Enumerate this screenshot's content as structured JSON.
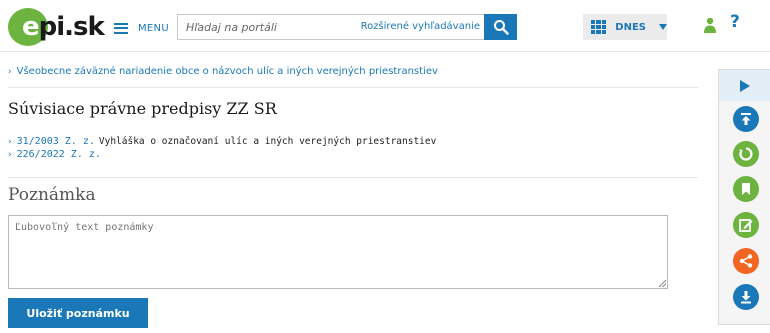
{
  "header": {
    "logo_text": "epi.sk",
    "menu_label": "MENU",
    "search_placeholder": "Hľadaj na portáli",
    "advanced_search": "Rozšírené vyhľadávanie",
    "dnes_label": "DNES"
  },
  "main": {
    "top_link": "Všeobecne záväzné nariadenie obce o názvoch ulíc a iných verejných priestranstiev",
    "related_title": "Súvisiace právne predpisy ZZ SR",
    "related": [
      {
        "number": "31/2003 Z. z.",
        "description": "Vyhláška o označovaní ulíc a iných verejných priestranstiev"
      },
      {
        "number": "226/2022 Z. z.",
        "description": ""
      }
    ],
    "note_title": "Poznámka",
    "note_placeholder": "Ľubovoľný text poznámky",
    "save_button": "Uložiť poznámku"
  },
  "colors": {
    "primary": "#1a78b8",
    "green": "#6cb33f",
    "orange": "#f26522"
  },
  "rail": {
    "icons": [
      "play-icon",
      "upload-top-icon",
      "history-icon",
      "bookmark-icon",
      "edit-icon",
      "share-icon",
      "download-icon"
    ]
  }
}
